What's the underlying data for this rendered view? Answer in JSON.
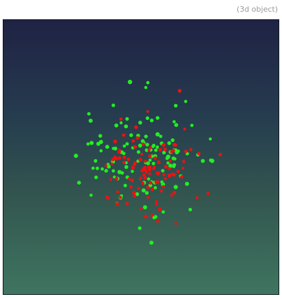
{
  "viewer": {
    "label": "(3d object)",
    "background_top": "#1f2244",
    "background_bottom": "#3f7560"
  },
  "scatter3d": {
    "series": [
      {
        "name": "",
        "color": "#22ee22"
      },
      {
        "name": "",
        "color": "#ee1111"
      }
    ]
  }
}
